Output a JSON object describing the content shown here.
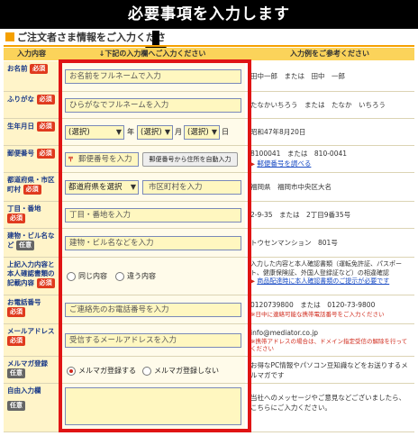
{
  "banner": "必要事項を入力します",
  "section_title": "ご注文者さま情報をご入力くださ",
  "headers": {
    "label": "入力内容",
    "field": "↓下記の入力欄へご入力ください",
    "example": "入力例をご参考ください"
  },
  "tags": {
    "required": "必須",
    "optional": "任意"
  },
  "rows": {
    "name": {
      "label": "お名前",
      "placeholder": "お名前をフルネームで入力",
      "example": "田中一郎　または　田中　一郎"
    },
    "kana": {
      "label": "ふりがな",
      "placeholder": "ひらがなでフルネームを入力",
      "example": "たなかいちろう　または　たなか　いちろう"
    },
    "birth": {
      "label": "生年月日",
      "year_select": "(選択)",
      "month_select": "(選択)",
      "day_select": "(選択)",
      "year_unit": "年",
      "month_unit": "月",
      "day_unit": "日",
      "example": "昭和47年8月20日"
    },
    "postal": {
      "label": "郵便番号",
      "placeholder": "郵便番号を入力",
      "lookup_button": "郵便番号から住所を自動入力",
      "example_line1": "8100041　または　810-0041",
      "example_link": "郵便番号を調べる"
    },
    "pref": {
      "label": "都道府県・市区町村",
      "pref_select": "都道府県を選択",
      "city_placeholder": "市区町村を入力",
      "example": "福岡県　福岡市中央区大名"
    },
    "street": {
      "label": "丁目・番地",
      "placeholder": "丁目・番地を入力",
      "example": "2-9-35　または　2丁目9番35号"
    },
    "building": {
      "label": "建物・ビル名など",
      "placeholder": "建物・ビル名などを入力",
      "example": "トウセンマンション　801号"
    },
    "same": {
      "label": "上記入力内容と本人確認書類の記載内容",
      "opt_same": "同じ内容",
      "opt_diff": "違う内容",
      "example_line1": "入力した内容と本人確認書類（運転免許証、パスポート、健康保険証、外国人登録証など）の相違確認",
      "example_link": "商品配達時に本人確認書類のご提示が必要です"
    },
    "phone": {
      "label": "お電話番号",
      "placeholder": "ご連絡先のお電話番号を入力",
      "example_line1": "0120739800　または　0120-73-9800",
      "example_note": "※日中に連絡可能な携帯電話番号をご入力ください"
    },
    "email": {
      "label": "メールアドレス",
      "placeholder": "受信するメールアドレスを入力",
      "example_line1": "info@mediator.co.jp",
      "example_note": "※携帯アドレスの場合は、ドメイン指定受信の解除を行ってください"
    },
    "magazine": {
      "label": "メルマガ登録",
      "opt_yes": "メルマガ登録する",
      "opt_no": "メルマガ登録しない",
      "example": "お得なPC情報やパソコン豆知識などをお送りするメルマガです"
    },
    "free": {
      "label": "自由入力欄",
      "example": "当社へのメッセージやご意見などございましたら、こちらにご入力ください。"
    }
  },
  "colors": {
    "accent": "#f5a000",
    "required_tag": "#e03a1e",
    "frame": "#e01414",
    "input_bg": "#fff7c0"
  }
}
